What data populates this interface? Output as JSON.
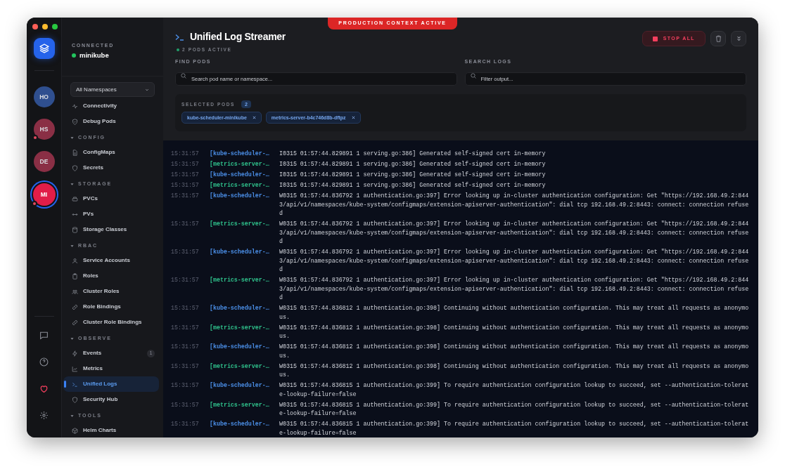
{
  "rail": {
    "clusters": [
      {
        "initials": "HO",
        "color": "#2f4f8f",
        "selected": false,
        "alert": false
      },
      {
        "initials": "HS",
        "color": "#8a2f45",
        "selected": false,
        "alert": true
      },
      {
        "initials": "DE",
        "color": "#8a2f45",
        "selected": false,
        "alert": false
      },
      {
        "initials": "MI",
        "color": "#e11d48",
        "selected": true,
        "alert": true
      }
    ]
  },
  "nav": {
    "connection_label": "CONNECTED",
    "cluster": "minikube",
    "connected": true,
    "namespace_select": {
      "value": "All Namespaces"
    },
    "sections": [
      {
        "items": [
          {
            "label": "Connectivity",
            "selected": false
          },
          {
            "label": "Debug Pods",
            "selected": false
          }
        ]
      },
      {
        "title": "CONFIG",
        "expanded": true,
        "items": [
          {
            "label": "ConfigMaps",
            "selected": false
          },
          {
            "label": "Secrets",
            "selected": false
          }
        ]
      },
      {
        "title": "STORAGE",
        "expanded": true,
        "items": [
          {
            "label": "PVCs",
            "selected": false
          },
          {
            "label": "PVs",
            "selected": false
          },
          {
            "label": "Storage Classes",
            "selected": false
          }
        ]
      },
      {
        "title": "RBAC",
        "expanded": true,
        "items": [
          {
            "label": "Service Accounts",
            "selected": false
          },
          {
            "label": "Roles",
            "selected": false
          },
          {
            "label": "Cluster Roles",
            "selected": false
          },
          {
            "label": "Role Bindings",
            "selected": false
          },
          {
            "label": "Cluster Role Bindings",
            "selected": false
          }
        ]
      },
      {
        "title": "OBSERVE",
        "expanded": true,
        "items": [
          {
            "label": "Events",
            "selected": false,
            "badge": "1"
          },
          {
            "label": "Metrics",
            "selected": false
          },
          {
            "label": "Unified Logs",
            "selected": true
          },
          {
            "label": "Security Hub",
            "selected": false
          }
        ]
      },
      {
        "title": "TOOLS",
        "expanded": true,
        "items": [
          {
            "label": "Helm Charts",
            "selected": false
          }
        ]
      }
    ]
  },
  "banner": "PRODUCTION CONTEXT ACTIVE",
  "header": {
    "title": "Unified Log Streamer",
    "status": "2 PODS ACTIVE",
    "stop_button": "STOP ALL"
  },
  "find_pods": {
    "label": "FIND PODS",
    "placeholder": "Search pod name or namespace..."
  },
  "search_logs": {
    "label": "SEARCH LOGS",
    "placeholder": "Filter output..."
  },
  "selected_pods": {
    "label": "SELECTED PODS",
    "count": "2",
    "pods": [
      "kube-scheduler-minikube",
      "metrics-server-b4c746d8b-dftpz"
    ]
  },
  "logs": [
    {
      "time": "15:31:57",
      "pod": "[kube-scheduler-…",
      "color": "#4b8fe8",
      "message": "I0315 01:57:44.829891 1 serving.go:386] Generated self-signed cert in-memory"
    },
    {
      "time": "15:31:57",
      "pod": "[metrics-server-…",
      "color": "#2fc28c",
      "message": "I0315 01:57:44.829891 1 serving.go:386] Generated self-signed cert in-memory"
    },
    {
      "time": "15:31:57",
      "pod": "[kube-scheduler-…",
      "color": "#4b8fe8",
      "message": "I0315 01:57:44.829891 1 serving.go:386] Generated self-signed cert in-memory"
    },
    {
      "time": "15:31:57",
      "pod": "[metrics-server-…",
      "color": "#2fc28c",
      "message": "I0315 01:57:44.829891 1 serving.go:386] Generated self-signed cert in-memory"
    },
    {
      "time": "15:31:57",
      "pod": "[kube-scheduler-…",
      "color": "#4b8fe8",
      "message": "W0315 01:57:44.836792 1 authentication.go:397] Error looking up in-cluster authentication configuration: Get \"https://192.168.49.2:8443/api/v1/namespaces/kube-system/configmaps/extension-apiserver-authentication\": dial tcp 192.168.49.2:8443: connect: connection refused"
    },
    {
      "time": "15:31:57",
      "pod": "[metrics-server-…",
      "color": "#2fc28c",
      "message": "W0315 01:57:44.836792 1 authentication.go:397] Error looking up in-cluster authentication configuration: Get \"https://192.168.49.2:8443/api/v1/namespaces/kube-system/configmaps/extension-apiserver-authentication\": dial tcp 192.168.49.2:8443: connect: connection refused"
    },
    {
      "time": "15:31:57",
      "pod": "[kube-scheduler-…",
      "color": "#4b8fe8",
      "message": "W0315 01:57:44.836792 1 authentication.go:397] Error looking up in-cluster authentication configuration: Get \"https://192.168.49.2:8443/api/v1/namespaces/kube-system/configmaps/extension-apiserver-authentication\": dial tcp 192.168.49.2:8443: connect: connection refused"
    },
    {
      "time": "15:31:57",
      "pod": "[metrics-server-…",
      "color": "#2fc28c",
      "message": "W0315 01:57:44.836792 1 authentication.go:397] Error looking up in-cluster authentication configuration: Get \"https://192.168.49.2:8443/api/v1/namespaces/kube-system/configmaps/extension-apiserver-authentication\": dial tcp 192.168.49.2:8443: connect: connection refused"
    },
    {
      "time": "15:31:57",
      "pod": "[kube-scheduler-…",
      "color": "#4b8fe8",
      "message": "W0315 01:57:44.836812 1 authentication.go:398] Continuing without authentication configuration. This may treat all requests as anonymous."
    },
    {
      "time": "15:31:57",
      "pod": "[metrics-server-…",
      "color": "#2fc28c",
      "message": "W0315 01:57:44.836812 1 authentication.go:398] Continuing without authentication configuration. This may treat all requests as anonymous."
    },
    {
      "time": "15:31:57",
      "pod": "[kube-scheduler-…",
      "color": "#4b8fe8",
      "message": "W0315 01:57:44.836812 1 authentication.go:398] Continuing without authentication configuration. This may treat all requests as anonymous."
    },
    {
      "time": "15:31:57",
      "pod": "[metrics-server-…",
      "color": "#2fc28c",
      "message": "W0315 01:57:44.836812 1 authentication.go:398] Continuing without authentication configuration. This may treat all requests as anonymous."
    },
    {
      "time": "15:31:57",
      "pod": "[kube-scheduler-…",
      "color": "#4b8fe8",
      "message": "W0315 01:57:44.836815 1 authentication.go:399] To require authentication configuration lookup to succeed, set --authentication-tolerate-lookup-failure=false"
    },
    {
      "time": "15:31:57",
      "pod": "[metrics-server-…",
      "color": "#2fc28c",
      "message": "W0315 01:57:44.836815 1 authentication.go:399] To require authentication configuration lookup to succeed, set --authentication-tolerate-lookup-failure=false"
    },
    {
      "time": "15:31:57",
      "pod": "[kube-scheduler-…",
      "color": "#4b8fe8",
      "message": "W0315 01:57:44.836815 1 authentication.go:399] To require authentication configuration lookup to succeed, set --authentication-tolerate-lookup-failure=false"
    }
  ]
}
